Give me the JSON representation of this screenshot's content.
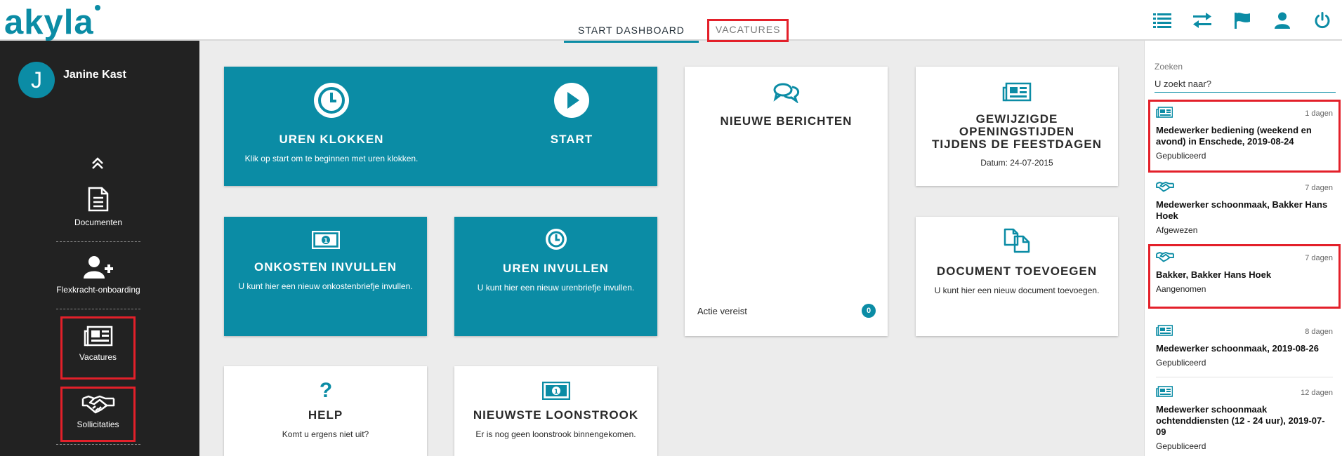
{
  "app": {
    "logo": "akyla",
    "accent": "#0b8ca5",
    "highlight": "#e3202a"
  },
  "header": {
    "tabs": [
      {
        "label": "START DASHBOARD",
        "active": true
      },
      {
        "label": "VACATURES",
        "active": false
      }
    ],
    "icons": [
      "list-icon",
      "transfer-icon",
      "flag-icon",
      "user-icon",
      "power-icon"
    ]
  },
  "sidebar": {
    "avatar_initial": "J",
    "user_name": "Janine Kast",
    "items": [
      {
        "label": "Documenten",
        "icon": "document-icon"
      },
      {
        "label": "Flexkracht-onboarding",
        "icon": "add-user-icon"
      },
      {
        "label": "Vacatures",
        "icon": "newspaper-icon"
      },
      {
        "label": "Sollicitaties",
        "icon": "handshake-icon"
      }
    ]
  },
  "tiles": {
    "uren_klokken": {
      "title": "UREN KLOKKEN",
      "sub": "Klik op start om te beginnen met uren klokken."
    },
    "start": {
      "title": "START"
    },
    "onkosten": {
      "title": "ONKOSTEN INVULLEN",
      "sub": "U kunt hier een nieuw onkostenbriefje invullen."
    },
    "uren_invullen": {
      "title": "UREN INVULLEN",
      "sub": "U kunt hier een nieuw urenbriefje invullen."
    },
    "berichten": {
      "title": "NIEUWE BERICHTEN",
      "footer": "Actie vereist",
      "count": "0"
    },
    "gewijzigde": {
      "title": "GEWIJZIGDE OPENINGSTIJDEN TIJDENS DE FEESTDAGEN",
      "sub": "Datum: 24-07-2015"
    },
    "document": {
      "title": "DOCUMENT TOEVOEGEN",
      "sub": "U kunt hier een nieuw document toevoegen."
    },
    "help": {
      "title": "HELP",
      "sub": "Komt u ergens niet uit?"
    },
    "loonstrook": {
      "title": "NIEUWSTE LOONSTROOK",
      "sub": "Er is nog geen loonstrook binnengekomen."
    }
  },
  "search": {
    "label": "Zoeken",
    "placeholder": "U zoekt naar?"
  },
  "feed": [
    {
      "icon": "newspaper-icon",
      "days": "1 dagen",
      "title": "Medewerker bediening (weekend en avond) in Enschede, 2019-08-24",
      "status": "Gepubliceerd"
    },
    {
      "icon": "handshake-icon",
      "days": "7 dagen",
      "title": "Medewerker schoonmaak, Bakker Hans Hoek",
      "status": "Afgewezen"
    },
    {
      "icon": "handshake-icon",
      "days": "7 dagen",
      "title": "Bakker, Bakker Hans Hoek",
      "status": "Aangenomen"
    },
    {
      "icon": "newspaper-icon",
      "days": "8 dagen",
      "title": "Medewerker schoonmaak, 2019-08-26",
      "status": "Gepubliceerd"
    },
    {
      "icon": "newspaper-icon",
      "days": "12 dagen",
      "title": "Medewerker schoonmaak ochtenddiensten (12 - 24 uur), 2019-07-09",
      "status": "Gepubliceerd"
    }
  ]
}
